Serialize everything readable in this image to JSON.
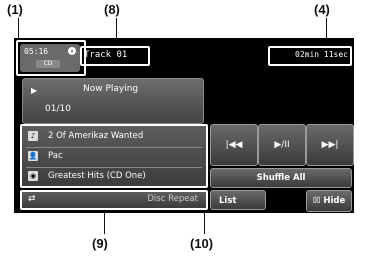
{
  "callouts": {
    "c1": "(1)",
    "c8": "(8)",
    "c4": "(4)",
    "c9": "(9)",
    "c10": "(10)"
  },
  "status": {
    "clock": "05:16",
    "source_tag": "CD",
    "track": "Track 01",
    "elapsed": "02min 11sec"
  },
  "now_playing": {
    "label": "Now Playing",
    "count": "01/10"
  },
  "info": [
    {
      "icon": "song-icon",
      "text": "2 Of Amerikaz Wanted"
    },
    {
      "icon": "artist-icon",
      "text": "Pac"
    },
    {
      "icon": "album-icon",
      "text": "Greatest Hits (CD One)"
    }
  ],
  "controls": {
    "prev": "|◀◀",
    "playpause": "▶/II",
    "next": "▶▶|",
    "shuffle": "Shuffle All",
    "list": "List",
    "hide": "☒ Hide"
  },
  "repeat": {
    "label": "Disc Repeat"
  }
}
